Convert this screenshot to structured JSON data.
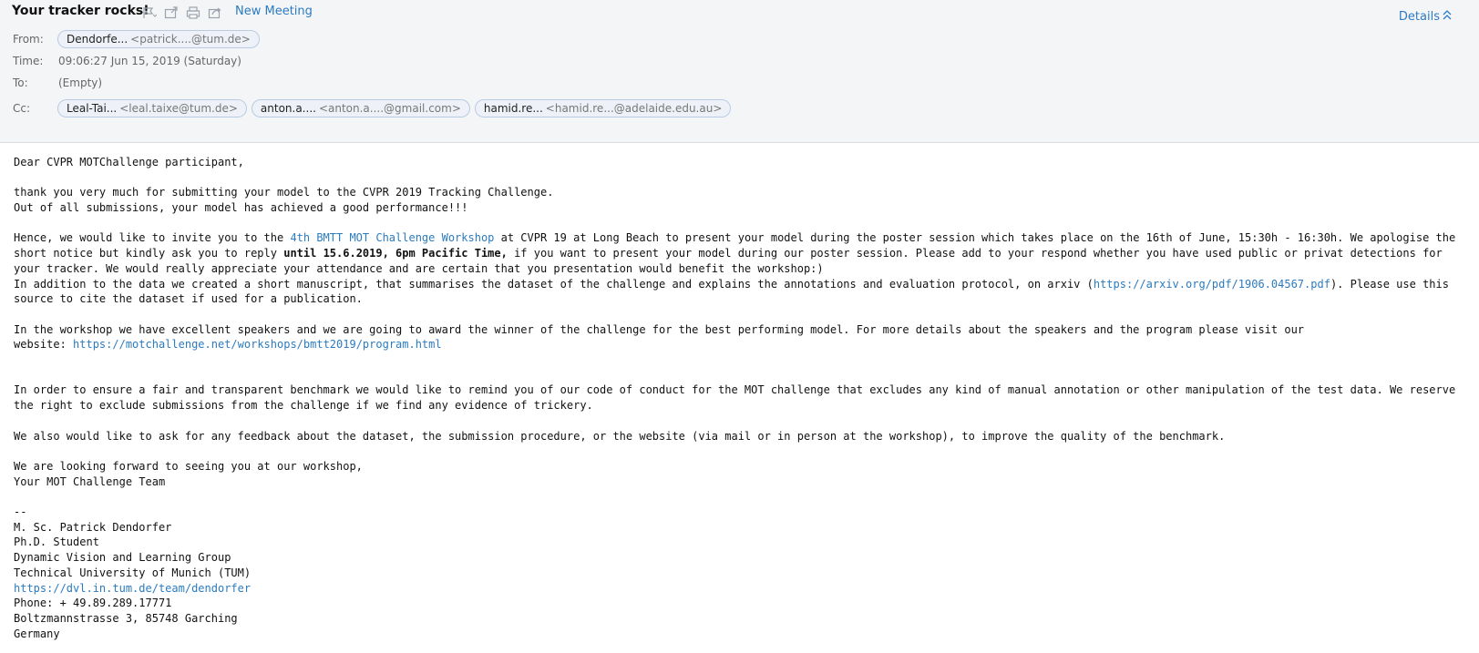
{
  "header": {
    "subject": "Your tracker rocks!",
    "new_meeting": "New Meeting",
    "details": "Details",
    "from_label": "From:",
    "time_label": "Time:",
    "to_label": "To:",
    "cc_label": "Cc:",
    "time_value": "09:06:27 Jun 15, 2019 (Saturday)",
    "to_value": "(Empty)",
    "from": {
      "name": "Dendorfe...",
      "email": "<patrick....@tum.de>"
    },
    "cc": [
      {
        "name": "Leal-Tai...",
        "email": "<leal.taixe@tum.de>"
      },
      {
        "name": "anton.a....",
        "email": "<anton.a....@gmail.com>"
      },
      {
        "name": "hamid.re...",
        "email": "<hamid.re...@adelaide.edu.au>"
      }
    ],
    "icons": [
      "flag-icon",
      "move-icon",
      "print-icon",
      "export-icon"
    ]
  },
  "body": {
    "greeting": "Dear CVPR MOTChallenge participant,",
    "p1_l1": "thank you very much for submitting your model to the CVPR 2019 Tracking Challenge.",
    "p1_l2": "Out of all submissions, your model has achieved a good performance!!!",
    "p2_a": "Hence, we would like to invite you to the ",
    "p2_link": "4th BMTT MOT Challenge Workshop",
    "p2_b": " at CVPR 19 at Long Beach to present your model during the poster session which takes place on the 16th of June, 15:30h - 16:30h. We apologise the short notice but kindly ask you to reply ",
    "p2_bold": "until 15.6.2019, 6pm Pacific Time,",
    "p2_c": " if you want to present your model during our poster session. Please add to your respond whether you have used public or privat detections for your tracker. We would really appreciate your attendance and are certain that you presentation would benefit the workshop:)",
    "p3_a": "In addition to the data we created a short manuscript, that summarises the dataset of the challenge and explains the annotations and evaluation protocol, on arxiv (",
    "p3_link": "https://arxiv.org/pdf/1906.04567.pdf",
    "p3_b": "). Please use this source to cite the dataset if used for a publication.",
    "p4_a": "In the workshop we have excellent speakers and we are going to award the winner of the challenge for the best performing model. For more details about the speakers and the program please visit our",
    "p4_b": "website: ",
    "p4_link": "https://motchallenge.net/workshops/bmtt2019/program.html",
    "p5": "In order to ensure a fair and transparent benchmark we would like to remind you of our code of conduct for the MOT challenge that excludes any kind of manual annotation or other manipulation of the test data. We reserve the right to exclude submissions from the challenge if we find any evidence of trickery.",
    "p6": "We also would like to ask for any feedback about the dataset, the submission procedure, or the website (via mail or in person at the workshop), to improve the quality of the benchmark.",
    "p7_l1": "We are looking forward to seeing you at our workshop,",
    "p7_l2": "Your MOT Challenge Team",
    "sig_sep": "--",
    "sig_name": "M. Sc. Patrick Dendorfer",
    "sig_title": "Ph.D. Student",
    "sig_group": "Dynamic Vision and Learning Group",
    "sig_univ": "Technical University of Munich (TUM)",
    "sig_link": "https://dvl.in.tum.de/team/dendorfer",
    "sig_phone": "Phone: + 49.89.289.17771",
    "sig_addr": "Boltzmannstrasse 3, 85748 Garching",
    "sig_country": "Germany"
  }
}
